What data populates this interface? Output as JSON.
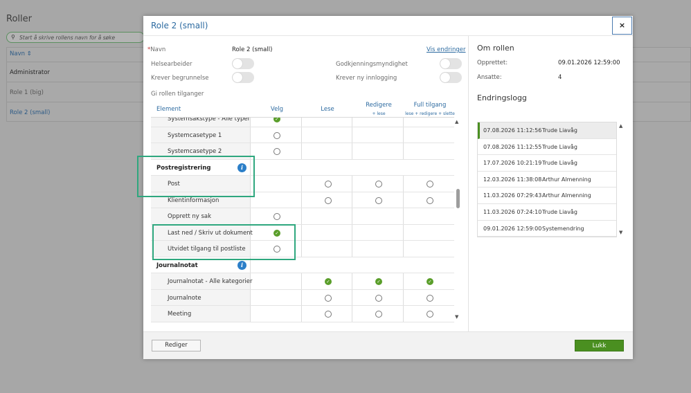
{
  "background": {
    "title": "Roller",
    "search_placeholder": "Start å skrive rollens navn for å søke",
    "table_header": "Navn",
    "rows": [
      "Administrator",
      "Role 1 (big)",
      "Role 2 (small)"
    ]
  },
  "modal": {
    "title": "Role 2 (small)",
    "close_symbol": "×",
    "name_label": "Navn",
    "name_required": "*",
    "name_value": "Role 2 (small)",
    "show_changes_link": "Vis endringer",
    "toggles": {
      "helsearbeider": "Helsearbeider",
      "krever_begrunnelse": "Krever begrunnelse",
      "godkjenningsmyndighet": "Godkjenningsmyndighet",
      "krever_ny_innlogging": "Krever ny innlogging"
    },
    "grant_access_label": "Gi rollen tilganger",
    "columns": {
      "element": "Element",
      "velg": "Velg",
      "lese": "Lese",
      "redigere": "Redigere",
      "redigere_sub": "+ lese",
      "full": "Full tilgang",
      "full_sub": "lese + redigere + slette"
    },
    "grid_rows": [
      {
        "label": "Systemsakstype - Alle typer",
        "group": false,
        "velg": "check",
        "lese": "",
        "redigere": "",
        "full": ""
      },
      {
        "label": "Systemcasetype 1",
        "group": false,
        "velg": "radio",
        "lese": "",
        "redigere": "",
        "full": ""
      },
      {
        "label": "Systemcasetype 2",
        "group": false,
        "velg": "radio",
        "lese": "",
        "redigere": "",
        "full": ""
      },
      {
        "label": "Postregistrering",
        "group": true,
        "velg": "",
        "lese": "",
        "redigere": "",
        "full": ""
      },
      {
        "label": "Post",
        "group": false,
        "velg": "",
        "lese": "radio",
        "redigere": "radio",
        "full": "radio"
      },
      {
        "label": "Klientinformasjon",
        "group": false,
        "velg": "",
        "lese": "radio",
        "redigere": "radio",
        "full": "radio"
      },
      {
        "label": "Opprett ny sak",
        "group": false,
        "velg": "radio",
        "lese": "",
        "redigere": "",
        "full": ""
      },
      {
        "label": "Last ned / Skriv ut dokument",
        "group": false,
        "velg": "check",
        "lese": "",
        "redigere": "",
        "full": ""
      },
      {
        "label": "Utvidet tilgang til postliste",
        "group": false,
        "velg": "radio",
        "lese": "",
        "redigere": "",
        "full": ""
      },
      {
        "label": "Journalnotat",
        "group": true,
        "velg": "",
        "lese": "",
        "redigere": "",
        "full": ""
      },
      {
        "label": "Journalnotat - Alle kategorier",
        "group": false,
        "velg": "",
        "lese": "check",
        "redigere": "check",
        "full": "check"
      },
      {
        "label": "Journalnote",
        "group": false,
        "velg": "",
        "lese": "radio",
        "redigere": "radio",
        "full": "radio"
      },
      {
        "label": "Meeting",
        "group": false,
        "velg": "",
        "lese": "radio",
        "redigere": "radio",
        "full": "radio"
      }
    ],
    "info_symbol": "i",
    "check_symbol": "✓",
    "scroll_up": "▲",
    "scroll_down": "▼",
    "about": {
      "title": "Om rollen",
      "created_label": "Opprettet:",
      "created_value": "09.01.2026 12:59:00",
      "employees_label": "Ansatte:",
      "employees_value": "4"
    },
    "changelog": {
      "title": "Endringslogg",
      "entries": [
        {
          "date": "07.08.2026 11:12:56",
          "user": "Trude Liavåg"
        },
        {
          "date": "07.08.2026 11:12:55",
          "user": "Trude Liavåg"
        },
        {
          "date": "17.07.2026 10:21:19",
          "user": "Trude Liavåg"
        },
        {
          "date": "12.03.2026 11:38:08",
          "user": "Arthur Almenning"
        },
        {
          "date": "11.03.2026 07:29:43",
          "user": "Arthur Almenning"
        },
        {
          "date": "11.03.2026 07:24:10",
          "user": "Trude Liavåg"
        },
        {
          "date": "09.01.2026 12:59:00",
          "user": "Systemendring"
        }
      ]
    },
    "footer": {
      "edit_label": "Rediger",
      "close_label": "Lukk"
    }
  },
  "colors": {
    "accent": "#2c6aa0",
    "primary_button": "#4a8f20",
    "highlight": "#2ea77e"
  }
}
